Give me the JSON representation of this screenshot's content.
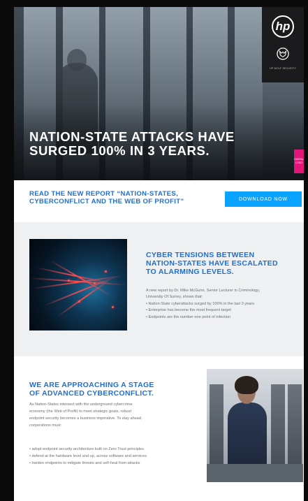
{
  "hero": {
    "headline_line1": "NATION-STATE ATTACKS HAVE",
    "headline_line2": "SURGED 100% IN 3 YEARS.",
    "badge_caption": "HP WOLF SECURITY",
    "digital_logo_label": "DIGITAL LOGO"
  },
  "report": {
    "line1": "READ THE NEW REPORT “NATION-STATES,",
    "line2": "CYBERCONFLICT AND THE WEB OF PROFIT”",
    "button_label": "DOWNLOAD NOW"
  },
  "tensions": {
    "title_line1": "CYBER TENSIONS BETWEEN",
    "title_line2": "NATION-STATES HAVE ESCALATED",
    "title_line3": "TO ALARMING LEVELS.",
    "intro_line1": "A new report by Dr. Mike McGuire, Senior Lecturer in Criminology,",
    "intro_line2": "University Of Surrey, shows that:",
    "bullets": [
      "• Nation-State cyberattacks surged by 100% in the last 3 years",
      "• Enterprise has become the most frequent target",
      "• Endpoints are the number one point of infection"
    ]
  },
  "stage": {
    "title_line1": "WE ARE APPROACHING A STAGE",
    "title_line2": "OF ADVANCED CYBERCONFLICT.",
    "body_lines": [
      "As Nation-States intersect with the underground cybercrime",
      "economy (the Web of Profit) to meet strategic goals, robust",
      "endpoint security becomes a business imperative. To stay ahead,",
      "corporations must:"
    ],
    "bullets": [
      "• adopt endpoint security architecture built on Zero Trust principles",
      "• defend at the hardware level and up, across software and services",
      "• harden endpoints to mitigate threats and self-heal from attacks"
    ]
  },
  "colors": {
    "accent_blue": "#1f6fd0",
    "button_blue": "#0aa3ff",
    "section_gray": "#eef0f2",
    "digital_pink": "#e2157a"
  },
  "icons": [
    "hp-logo-icon",
    "wolf-icon"
  ]
}
